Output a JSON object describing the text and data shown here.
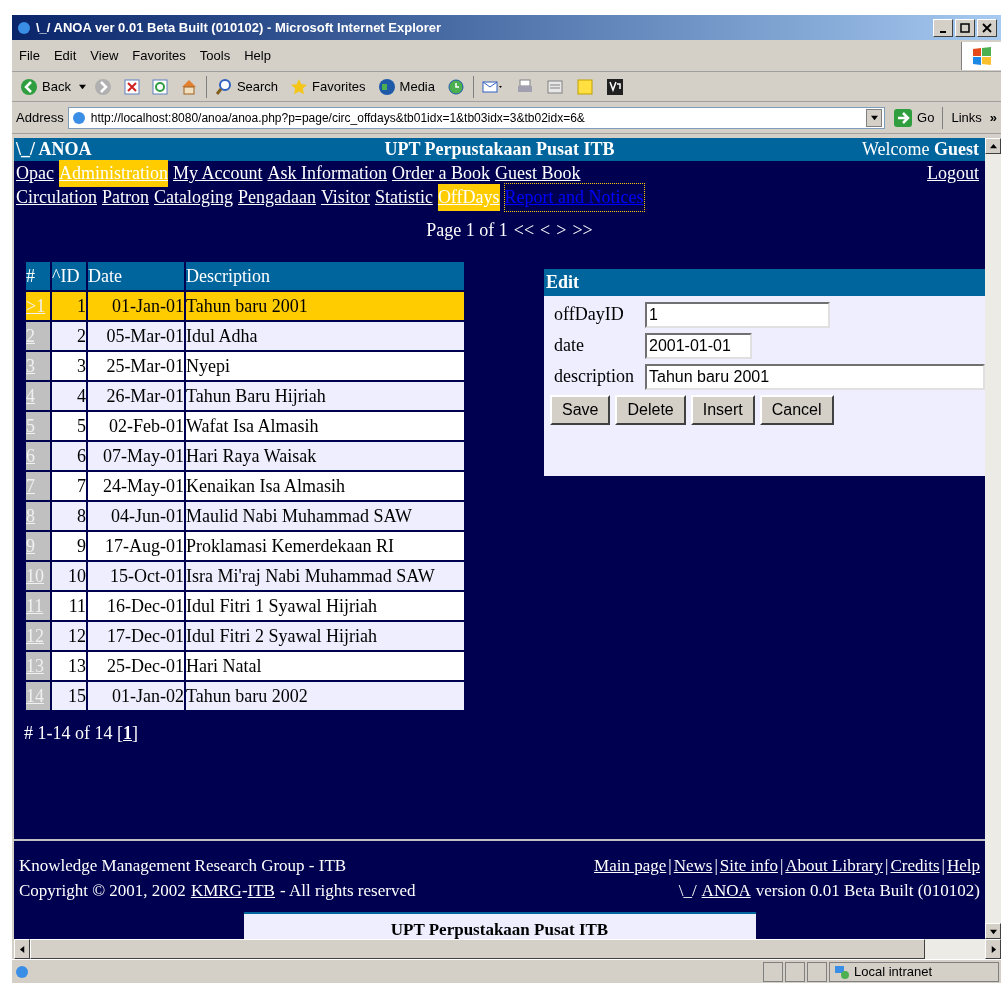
{
  "window": {
    "title": "\\_/ ANOA ver 0.01 Beta Built (010102) - Microsoft Internet Explorer"
  },
  "menu": [
    "File",
    "Edit",
    "View",
    "Favorites",
    "Tools",
    "Help"
  ],
  "toolbar": {
    "back": "Back",
    "search": "Search",
    "favorites": "Favorites",
    "media": "Media"
  },
  "address": {
    "label": "Address",
    "url": "http://localhost:8080/anoa/anoa.php?p=page/circ_offdays&tb01idx=1&tb03idx=3&tb02idx=6&",
    "go": "Go",
    "links": "Links",
    "more": "»"
  },
  "header": {
    "brand": "\\_/ ANOA",
    "title": "UPT Perpustakaan Pusat ITB",
    "welcome": "Welcome",
    "user": "Guest"
  },
  "nav_main": [
    {
      "label": "Opac",
      "selected": false
    },
    {
      "label": "Administration",
      "selected": true
    },
    {
      "label": "My Account",
      "selected": false
    },
    {
      "label": "Ask Information",
      "selected": false
    },
    {
      "label": "Order a Book",
      "selected": false
    },
    {
      "label": "Guest Book",
      "selected": false
    }
  ],
  "logout": "Logout",
  "nav_sub": [
    {
      "label": "Circulation",
      "selected": false,
      "focused": false
    },
    {
      "label": "Patron",
      "selected": false,
      "focused": false
    },
    {
      "label": "Cataloging",
      "selected": false,
      "focused": false
    },
    {
      "label": "Pengadaan",
      "selected": false,
      "focused": false
    },
    {
      "label": "Visitor",
      "selected": false,
      "focused": false
    },
    {
      "label": "Statistic",
      "selected": false,
      "focused": false
    },
    {
      "label": "OffDays",
      "selected": true,
      "focused": false
    },
    {
      "label": "Report and Notices",
      "selected": false,
      "focused": true
    }
  ],
  "pager": {
    "text": "Page 1 of 1",
    "first": "<<",
    "prev": "<",
    "next": ">",
    "last": ">>"
  },
  "table": {
    "columns": [
      "#",
      "^ID",
      "Date",
      "Description"
    ],
    "rows": [
      {
        "index": ">1",
        "id": "1",
        "date": "01-Jan-01",
        "description": "Tahun baru 2001",
        "selected": true
      },
      {
        "index": "2",
        "id": "2",
        "date": "05-Mar-01",
        "description": "Idul Adha",
        "selected": false
      },
      {
        "index": "3",
        "id": "3",
        "date": "25-Mar-01",
        "description": "Nyepi",
        "selected": false
      },
      {
        "index": "4",
        "id": "4",
        "date": "26-Mar-01",
        "description": "Tahun Baru Hijriah",
        "selected": false
      },
      {
        "index": "5",
        "id": "5",
        "date": "02-Feb-01",
        "description": "Wafat Isa Almasih",
        "selected": false
      },
      {
        "index": "6",
        "id": "6",
        "date": "07-May-01",
        "description": "Hari Raya Waisak",
        "selected": false
      },
      {
        "index": "7",
        "id": "7",
        "date": "24-May-01",
        "description": "Kenaikan Isa Almasih",
        "selected": false
      },
      {
        "index": "8",
        "id": "8",
        "date": "04-Jun-01",
        "description": "Maulid Nabi Muhammad SAW",
        "selected": false
      },
      {
        "index": "9",
        "id": "9",
        "date": "17-Aug-01",
        "description": "Proklamasi Kemerdekaan RI",
        "selected": false
      },
      {
        "index": "10",
        "id": "10",
        "date": "15-Oct-01",
        "description": "Isra Mi'raj Nabi Muhammad SAW",
        "selected": false
      },
      {
        "index": "11",
        "id": "11",
        "date": "16-Dec-01",
        "description": "Idul Fitri 1 Syawal Hijriah",
        "selected": false
      },
      {
        "index": "12",
        "id": "12",
        "date": "17-Dec-01",
        "description": "Idul Fitri 2 Syawal Hijriah",
        "selected": false
      },
      {
        "index": "13",
        "id": "13",
        "date": "25-Dec-01",
        "description": "Hari Natal",
        "selected": false
      },
      {
        "index": "14",
        "id": "15",
        "date": "01-Jan-02",
        "description": "Tahun baru 2002",
        "selected": false
      }
    ],
    "summary": "# 1-14 of 14 [",
    "page_link": "1",
    "summary_end": "]"
  },
  "edit": {
    "title": "Edit",
    "fields": [
      {
        "label": "offDayID",
        "value": "1"
      },
      {
        "label": "date",
        "value": "2001-01-01"
      },
      {
        "label": "description",
        "value": "Tahun baru 2001"
      }
    ],
    "buttons": [
      "Save",
      "Delete",
      "Insert",
      "Cancel"
    ]
  },
  "footer": {
    "org": "Knowledge Management Research Group - ITB",
    "copyright": "Copyright © 2001, 2002",
    "kmrg": "KMRG",
    "dash": "-",
    "itb": "ITB",
    "rights": "- All rights reserved",
    "links": [
      "Main page",
      "News",
      "Site info",
      "About Library",
      "Credits",
      "Help"
    ],
    "link_separator": "|",
    "version_prefix": "\\_/",
    "anoa": "ANOA",
    "version": "version 0.01 Beta Built (010102)",
    "box_title": "UPT Perpustakaan Pusat ITB"
  },
  "status": {
    "zone": "Local intranet"
  }
}
